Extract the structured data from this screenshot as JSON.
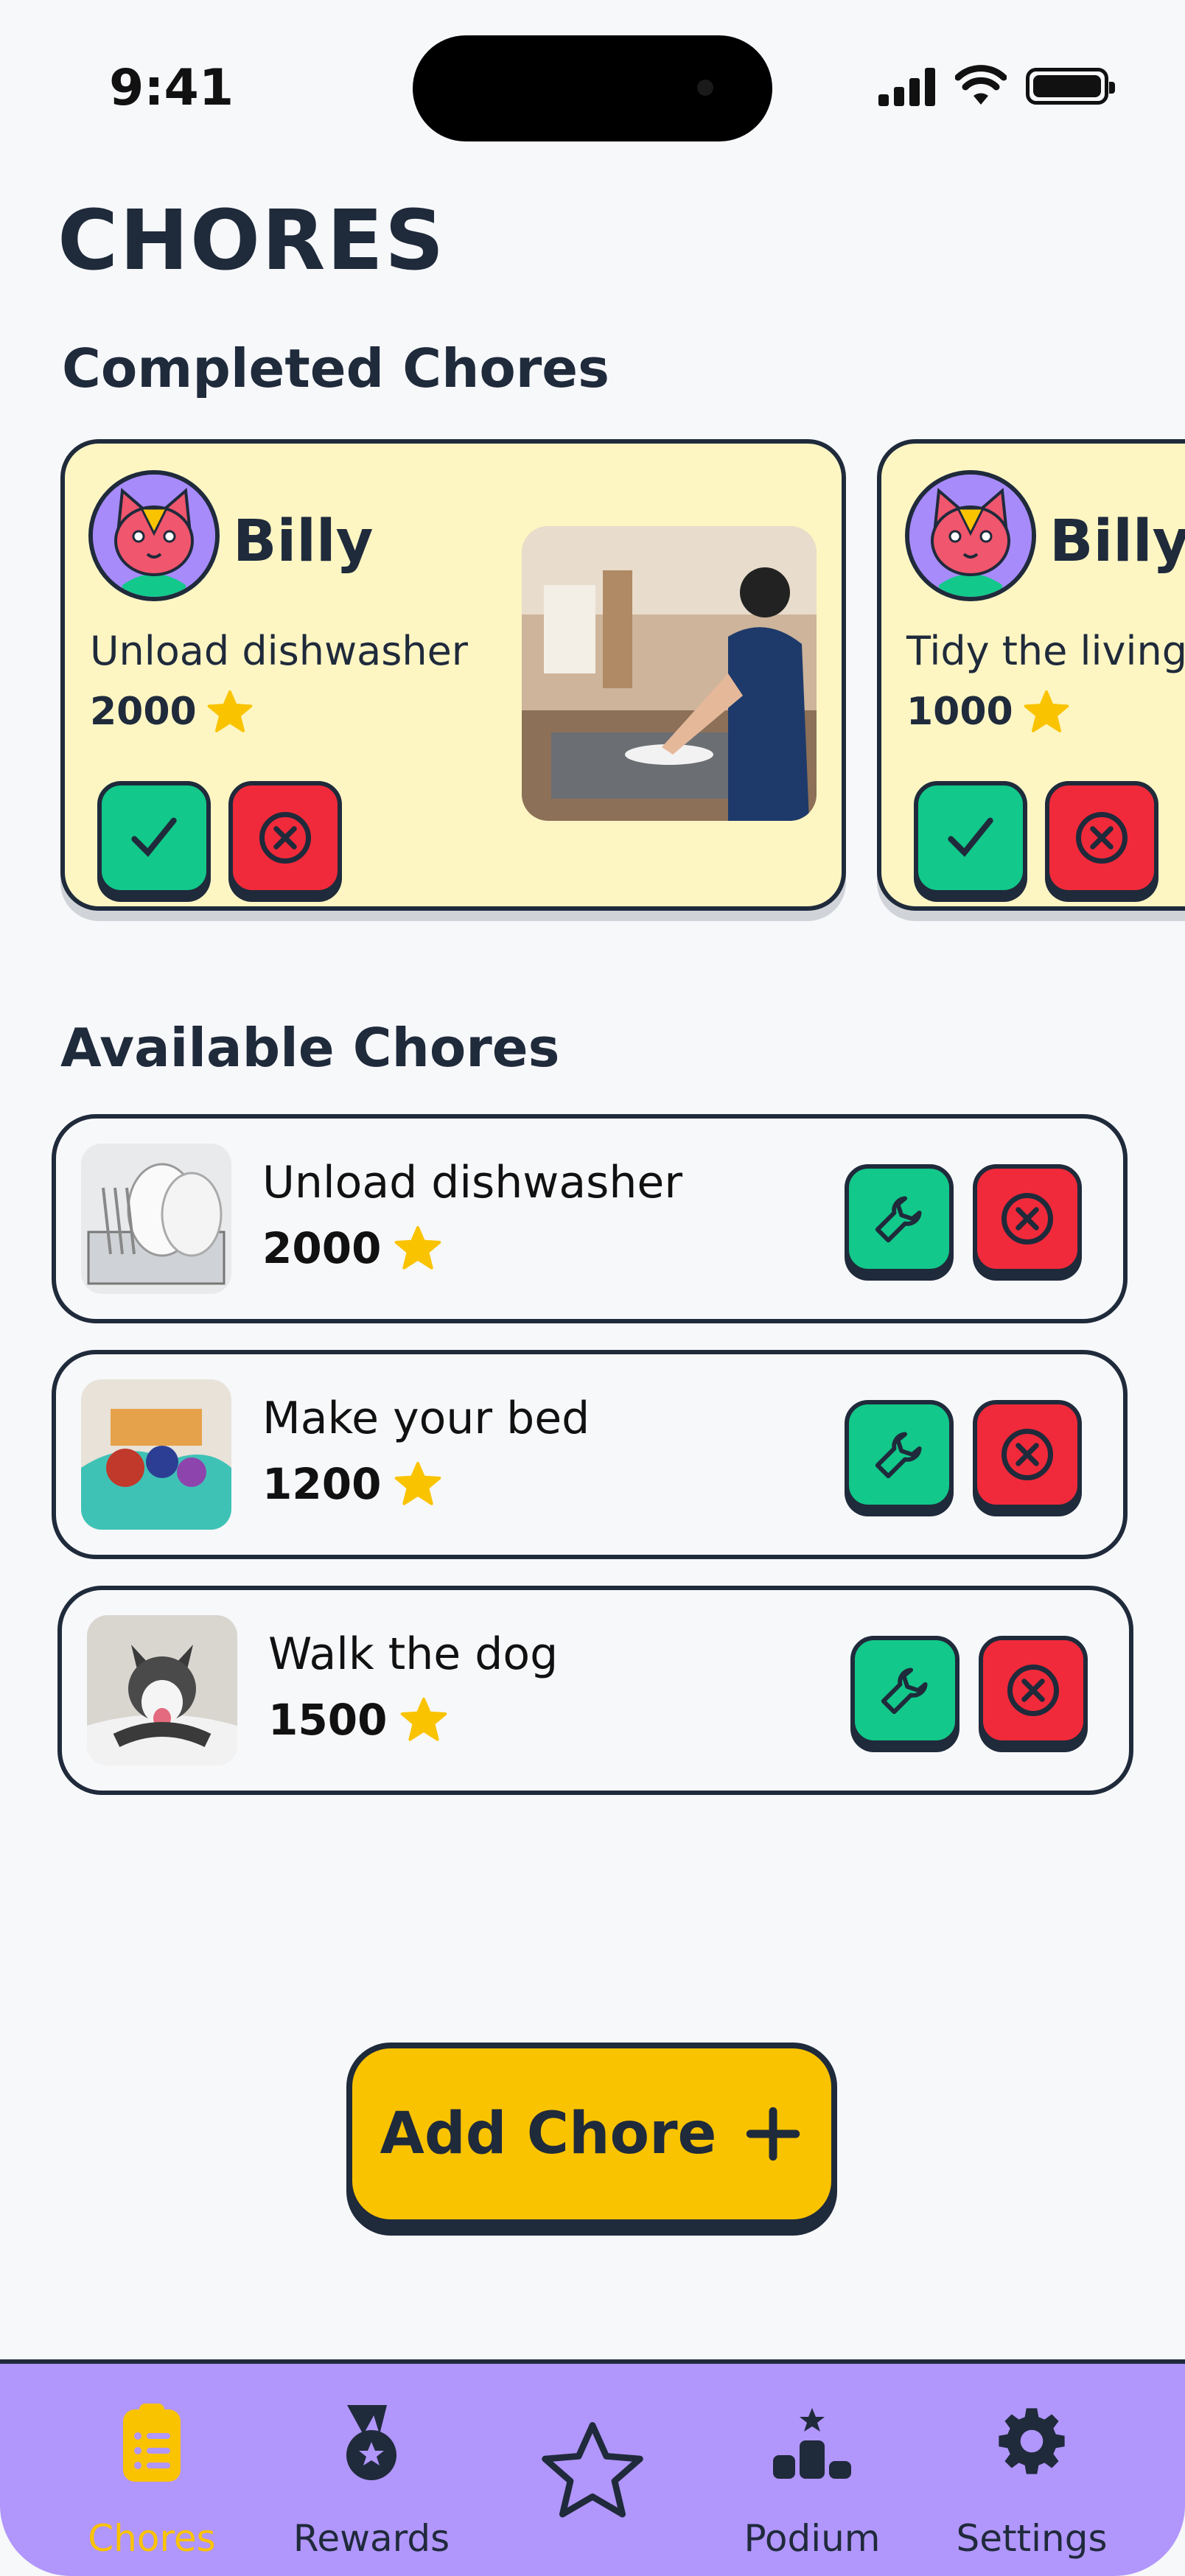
{
  "status_bar": {
    "time": "9:41"
  },
  "page": {
    "title": "CHORES"
  },
  "completed": {
    "title": "Completed Chores",
    "cards": [
      {
        "kid": "Billy",
        "chore": "Unload dishwasher",
        "points": "2000"
      },
      {
        "kid": "Billy",
        "chore": "Tidy the living room",
        "points": "1000"
      }
    ]
  },
  "available": {
    "title": "Available Chores",
    "items": [
      {
        "name": "Unload dishwasher",
        "points": "2000",
        "thumb": "dish-rack"
      },
      {
        "name": "Make your bed",
        "points": "1200",
        "thumb": "messy-bed"
      },
      {
        "name": "Walk the dog",
        "points": "1500",
        "thumb": "husky-dog"
      }
    ]
  },
  "add_button": {
    "label": "Add Chore"
  },
  "tabbar": {
    "items": [
      {
        "label": "Chores",
        "icon": "clipboard-icon",
        "active": true
      },
      {
        "label": "Rewards",
        "icon": "medal-icon"
      },
      {
        "label": "",
        "icon": "star-icon"
      },
      {
        "label": "Podium",
        "icon": "podium-icon"
      },
      {
        "label": "Settings",
        "icon": "gear-icon"
      }
    ]
  },
  "colors": {
    "accent_yellow": "#fac300",
    "green": "#12c88a",
    "red": "#f02a3a",
    "tabbar": "#b196fb",
    "card_yellow": "#fdf6c3",
    "ink": "#1f2a3b"
  }
}
